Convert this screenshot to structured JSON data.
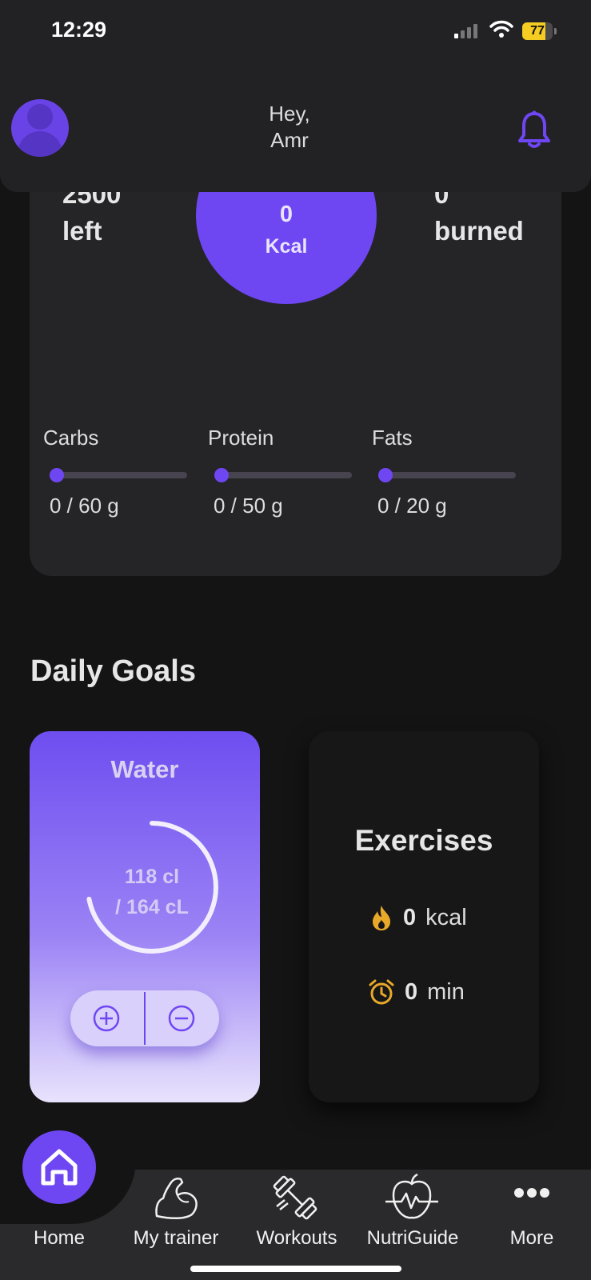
{
  "status_bar": {
    "time": "12:29",
    "battery": "77",
    "battery_level": 0.77
  },
  "header": {
    "greeting_line1": "Hey,",
    "greeting_line2": "Amr"
  },
  "summary": {
    "left_value": "2500",
    "left_label": "left",
    "kcal_value": "0",
    "kcal_unit": "Kcal",
    "burned_value": "0",
    "burned_label": "burned",
    "macros": [
      {
        "label": "Carbs",
        "value": "0 / 60 g",
        "progress": 0
      },
      {
        "label": "Protein",
        "value": "0 / 50 g",
        "progress": 0
      },
      {
        "label": "Fats",
        "value": "0 / 20 g",
        "progress": 0
      }
    ]
  },
  "goals": {
    "title": "Daily Goals",
    "water": {
      "title": "Water",
      "current": "118 cl",
      "target": "/ 164 cL",
      "progress": 0.72
    },
    "exercises": {
      "title": "Exercises",
      "kcal_value": "0",
      "kcal_unit": "kcal",
      "min_value": "0",
      "min_unit": "min"
    }
  },
  "nav": [
    {
      "label": "Home",
      "icon": "home-icon"
    },
    {
      "label": "My trainer",
      "icon": "bicep-icon"
    },
    {
      "label": "Workouts",
      "icon": "dumbbell-icon"
    },
    {
      "label": "NutriGuide",
      "icon": "apple-heartbeat-icon"
    },
    {
      "label": "More",
      "icon": "more-dots-icon"
    }
  ],
  "colors": {
    "accent": "#6e46f2",
    "background": "#141414",
    "card": "#252527",
    "exercise_icon": "#e8a92a"
  }
}
